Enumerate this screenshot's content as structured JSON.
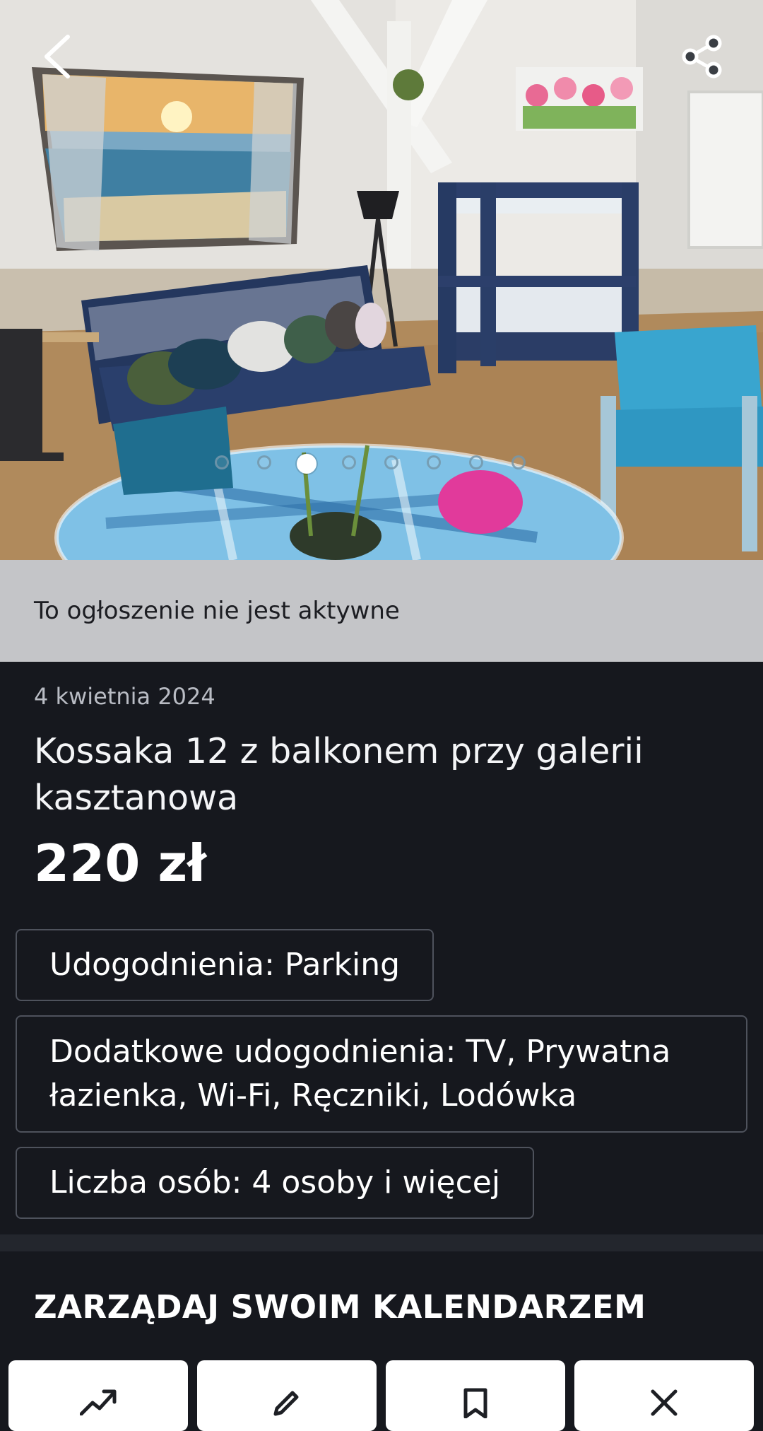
{
  "gallery": {
    "photo_count": 8,
    "active_photo_index": 2,
    "back_icon": "chevron-left-icon",
    "share_icon": "share-icon"
  },
  "banner": {
    "text": "To ogłoszenie nie jest aktywne"
  },
  "listing": {
    "date": "4 kwietnia 2024",
    "title": "Kossaka 12 z balkonem przy galerii kasztanowa",
    "price": "220 zł",
    "features": [
      {
        "text": "Udogodnienia: Parking"
      },
      {
        "text": "Dodatkowe udogodnienia: TV, Prywatna łazienka, Wi-Fi, Ręczniki, Lodówka"
      },
      {
        "text": "Liczba osób: 4 osoby i więcej"
      }
    ]
  },
  "calendar_section": {
    "title": "ZARZĄDAJ SWOIM KALENDARZEM",
    "actions": [
      {
        "icon": "trending-up-icon"
      },
      {
        "icon": "pencil-icon"
      },
      {
        "icon": "bookmark-icon"
      },
      {
        "icon": "close-icon"
      }
    ]
  },
  "colors": {
    "page_background": "#16181e",
    "banner_background": "#c4c5c8",
    "tag_border": "#4e525c"
  }
}
